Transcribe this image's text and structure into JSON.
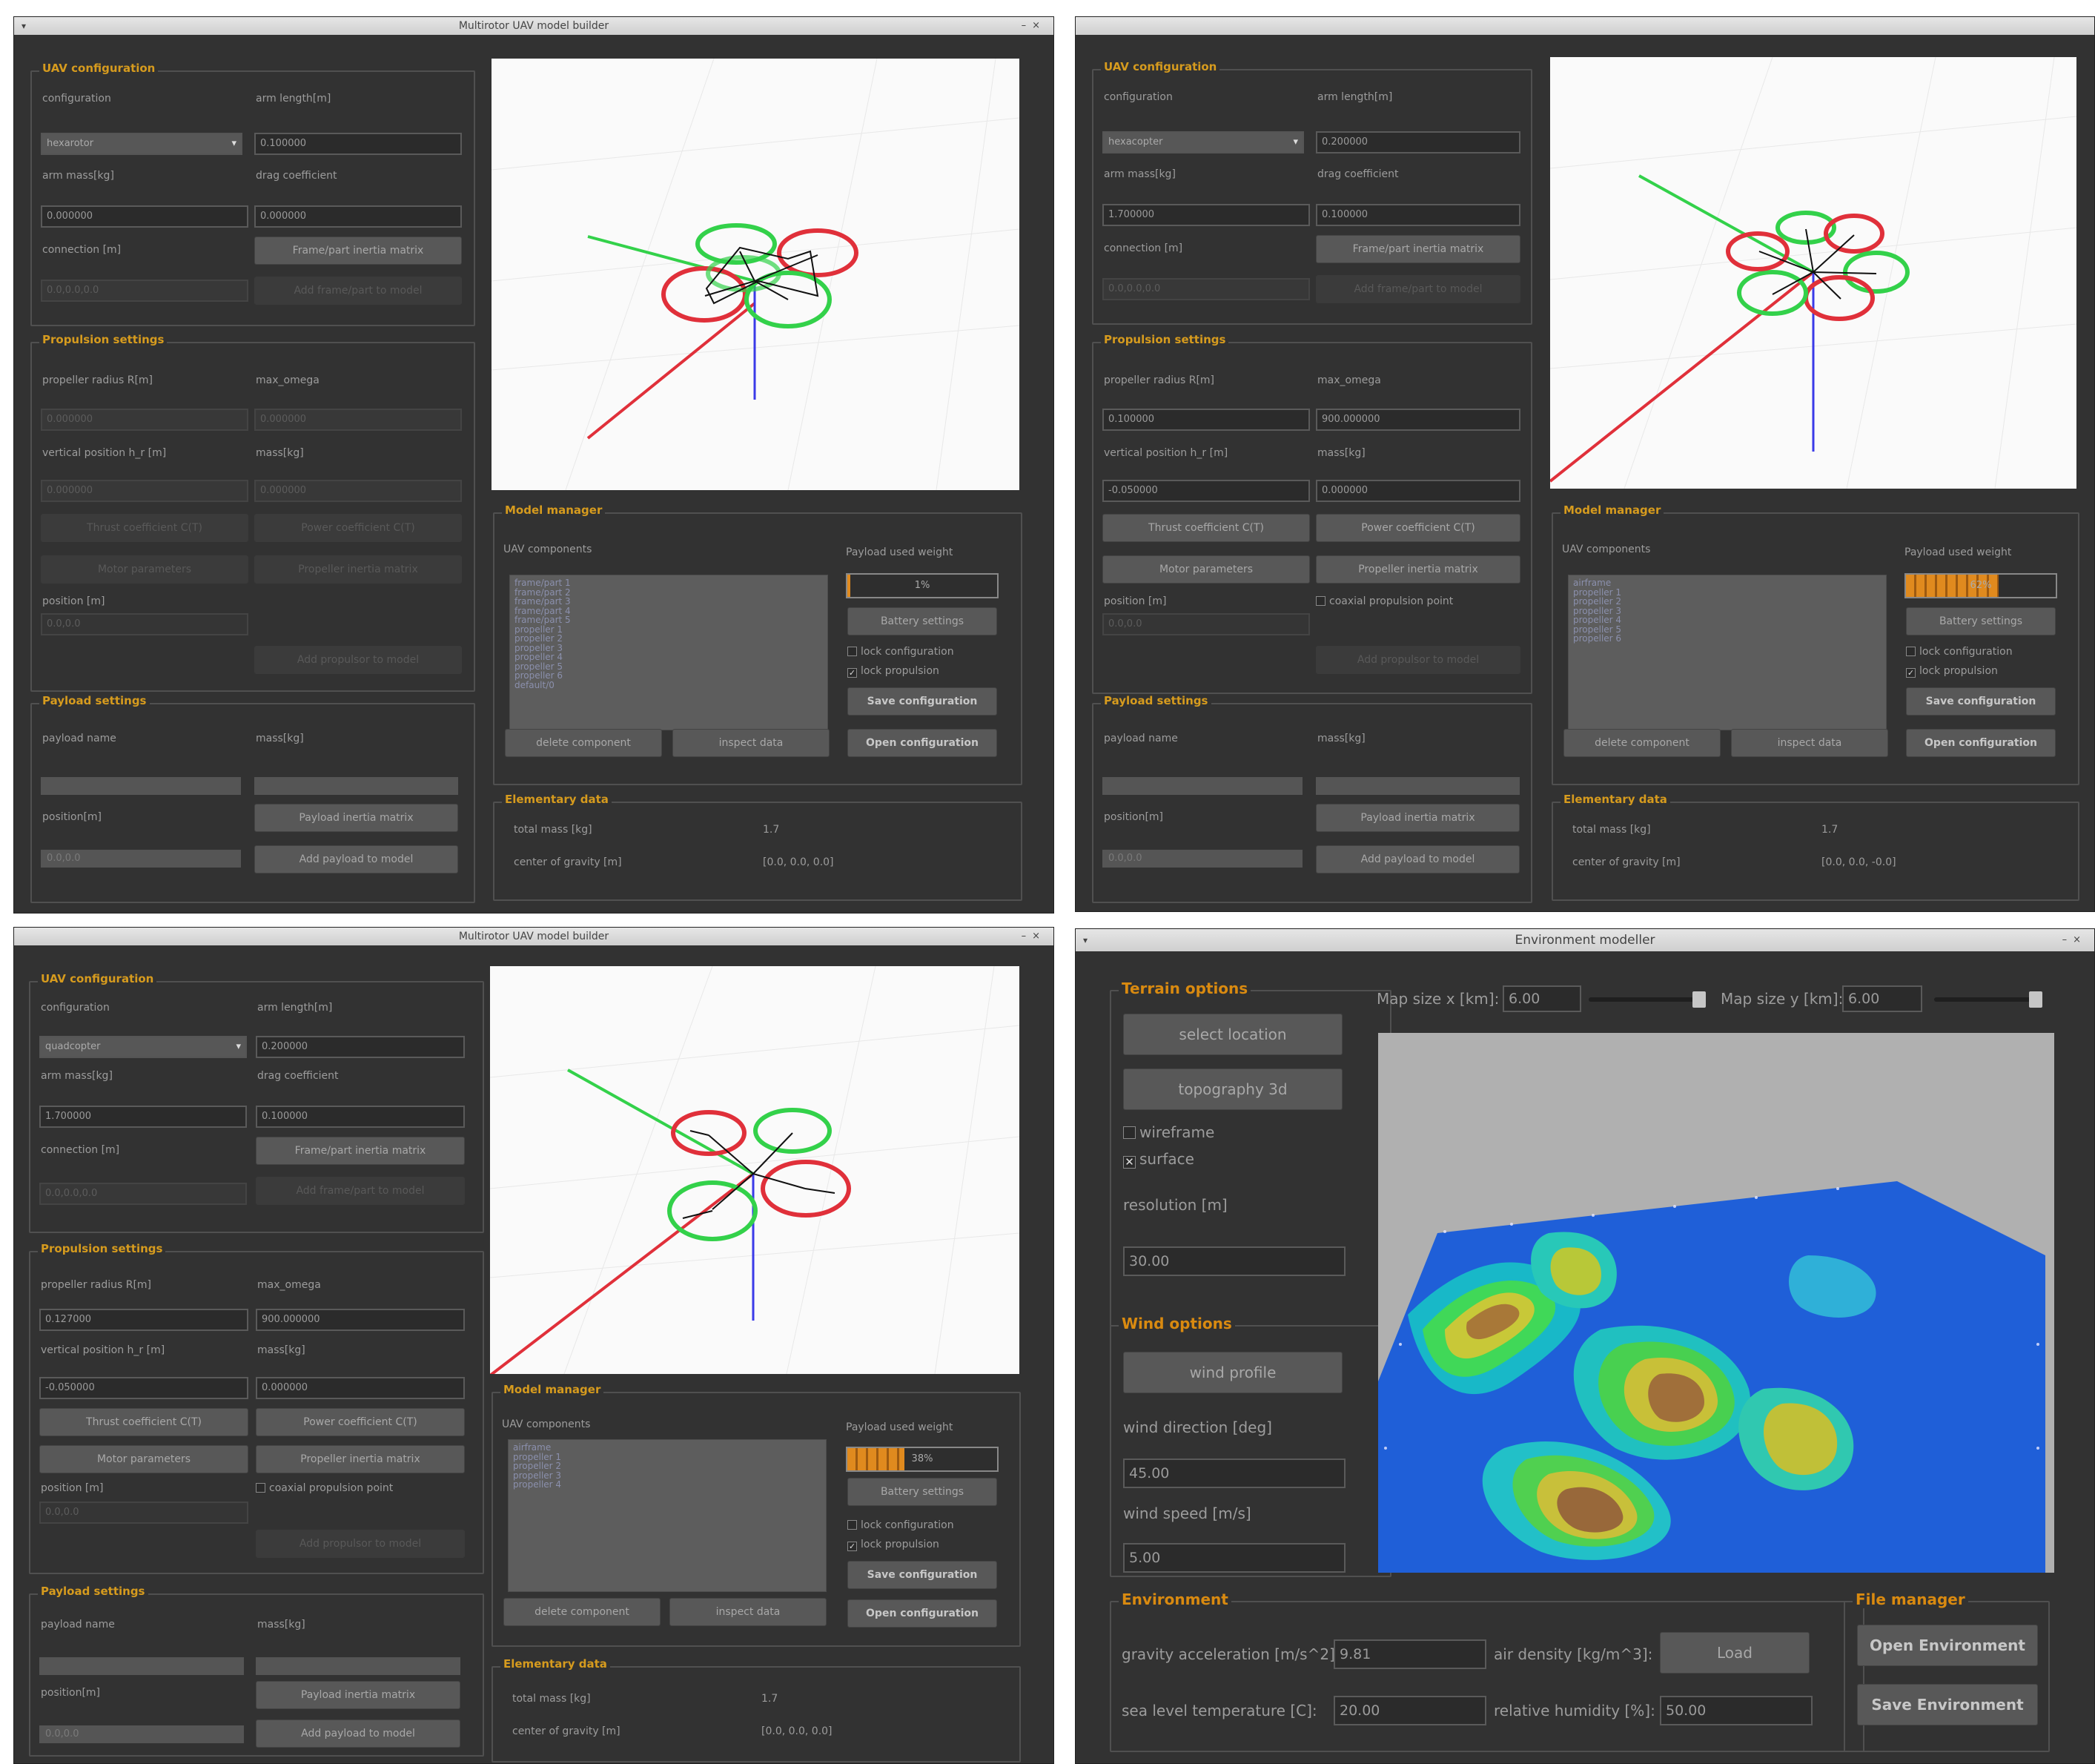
{
  "windows": {
    "w1": {
      "title": "Multirotor UAV model builder",
      "uav": {
        "section": "UAV configuration",
        "configuration_label": "configuration",
        "configuration_value": "hexarotor",
        "arm_length_label": "arm length[m]",
        "arm_length_value": "0.100000",
        "arm_mass_label": "arm mass[kg]",
        "arm_mass_value": "0.000000",
        "drag_label": "drag coefficient",
        "drag_value": "0.000000",
        "connection_label": "connection [m]",
        "connection_value": "0.0,0.0,0.0",
        "frame_btn": "Frame/part inertia matrix",
        "add_btn": "Add frame/part to model"
      },
      "prop": {
        "section": "Propulsion settings",
        "radius_label": "propeller radius R[m]",
        "radius_value": "0.000000",
        "omega_label": "max_omega",
        "omega_value": "0.000000",
        "vpos_label": "vertical position h_r [m]",
        "vpos_value": "0.000000",
        "mass_label": "mass[kg]",
        "mass_value": "0.000000",
        "thrust_btn": "Thrust coefficient C(T)",
        "power_btn": "Power coefficient C(T)",
        "motor_btn": "Motor parameters",
        "inertia_btn": "Propeller inertia matrix",
        "position_label": "position [m]",
        "position_value": "0.0,0.0",
        "add_btn": "Add propulsor to model"
      },
      "payload": {
        "section": "Payload settings",
        "name_label": "payload name",
        "mass_label": "mass[kg]",
        "position_label": "position[m]",
        "position_value": "0.0,0.0",
        "inertia_btn": "Payload inertia matrix",
        "add_btn": "Add payload to model"
      },
      "manager": {
        "section": "Model manager",
        "components_label": "UAV components",
        "components": [
          "frame/part 1",
          "frame/part 2",
          "frame/part 3",
          "frame/part 4",
          "frame/part 5",
          "propeller 1",
          "propeller 2",
          "propeller 3",
          "propeller 4",
          "propeller 5",
          "propeller 6",
          "default/0"
        ],
        "weight_label": "Payload used weight",
        "weight_pct": 0.02,
        "weight_text": "1%",
        "battery_btn": "Battery settings",
        "lock_config": "lock configuration",
        "lock_prop": "lock propulsion",
        "save_btn": "Save configuration",
        "open_btn": "Open configuration",
        "delete_btn": "delete component",
        "inspect_btn": "inspect data"
      },
      "elem": {
        "section": "Elementary data",
        "mass_label": "total mass [kg]",
        "mass_value": "1.7",
        "cog_label": "center of gravity [m]",
        "cog_value": "[0.0, 0.0, 0.0]"
      }
    },
    "w2": {
      "title": "",
      "uav": {
        "section": "UAV configuration",
        "configuration_label": "configuration",
        "configuration_value": "hexacopter",
        "arm_length_label": "arm length[m]",
        "arm_length_value": "0.200000",
        "arm_mass_label": "arm mass[kg]",
        "arm_mass_value": "1.700000",
        "drag_label": "drag coefficient",
        "drag_value": "0.100000",
        "connection_label": "connection [m]",
        "connection_value": "0.0,0.0,0.0",
        "frame_btn": "Frame/part inertia matrix",
        "add_btn": "Add frame/part to model"
      },
      "prop": {
        "section": "Propulsion settings",
        "radius_label": "propeller radius R[m]",
        "radius_value": "0.100000",
        "omega_label": "max_omega",
        "omega_value": "900.000000",
        "vpos_label": "vertical position h_r [m]",
        "vpos_value": "-0.050000",
        "mass_label": "mass[kg]",
        "mass_value": "0.000000",
        "thrust_btn": "Thrust coefficient C(T)",
        "power_btn": "Power coefficient C(T)",
        "motor_btn": "Motor parameters",
        "inertia_btn": "Propeller inertia matrix",
        "position_label": "position [m]",
        "coaxial": "coaxial propulsion point",
        "position_value": "0.0,0.0",
        "add_btn": "Add propulsor to model"
      },
      "payload": {
        "section": "Payload settings",
        "name_label": "payload name",
        "mass_label": "mass[kg]",
        "position_label": "position[m]",
        "position_value": "0.0,0.0",
        "inertia_btn": "Payload inertia matrix",
        "add_btn": "Add payload to model"
      },
      "manager": {
        "section": "Model manager",
        "components_label": "UAV components",
        "components": [
          "airframe",
          "propeller 1",
          "propeller 2",
          "propeller 3",
          "propeller 4",
          "propeller 5",
          "propeller 6"
        ],
        "weight_label": "Payload used weight",
        "weight_pct": 0.62,
        "weight_text": "62%",
        "battery_btn": "Battery settings",
        "lock_config": "lock configuration",
        "lock_prop": "lock propulsion",
        "save_btn": "Save configuration",
        "open_btn": "Open configuration",
        "delete_btn": "delete component",
        "inspect_btn": "inspect data"
      },
      "elem": {
        "section": "Elementary data",
        "mass_label": "total mass [kg]",
        "mass_value": "1.7",
        "cog_label": "center of gravity [m]",
        "cog_value": "[0.0, 0.0, -0.0]"
      }
    },
    "w3": {
      "title": "Multirotor UAV model builder",
      "uav": {
        "section": "UAV configuration",
        "configuration_label": "configuration",
        "configuration_value": "quadcopter",
        "arm_length_label": "arm length[m]",
        "arm_length_value": "0.200000",
        "arm_mass_label": "arm mass[kg]",
        "arm_mass_value": "1.700000",
        "drag_label": "drag coefficient",
        "drag_value": "0.100000",
        "connection_label": "connection [m]",
        "connection_value": "0.0,0.0,0.0",
        "frame_btn": "Frame/part inertia matrix",
        "add_btn": "Add frame/part to model"
      },
      "prop": {
        "section": "Propulsion settings",
        "radius_label": "propeller radius R[m]",
        "radius_value": "0.127000",
        "omega_label": "max_omega",
        "omega_value": "900.000000",
        "vpos_label": "vertical position h_r [m]",
        "vpos_value": "-0.050000",
        "mass_label": "mass[kg]",
        "mass_value": "0.000000",
        "thrust_btn": "Thrust coefficient C(T)",
        "power_btn": "Power coefficient C(T)",
        "motor_btn": "Motor parameters",
        "inertia_btn": "Propeller inertia matrix",
        "position_label": "position [m]",
        "coaxial": "coaxial propulsion point",
        "position_value": "0.0,0.0",
        "add_btn": "Add propulsor to model"
      },
      "payload": {
        "section": "Payload settings",
        "name_label": "payload name",
        "mass_label": "mass[kg]",
        "position_label": "position[m]",
        "position_value": "0.0,0.0",
        "inertia_btn": "Payload inertia matrix",
        "add_btn": "Add payload to model"
      },
      "manager": {
        "section": "Model manager",
        "components_label": "UAV components",
        "components": [
          "airframe",
          "propeller 1",
          "propeller 2",
          "propeller 3",
          "propeller 4"
        ],
        "weight_label": "Payload used weight",
        "weight_pct": 0.38,
        "weight_text": "38%",
        "battery_btn": "Battery settings",
        "lock_config": "lock configuration",
        "lock_prop": "lock propulsion",
        "save_btn": "Save configuration",
        "open_btn": "Open configuration",
        "delete_btn": "delete component",
        "inspect_btn": "inspect data"
      },
      "elem": {
        "section": "Elementary data",
        "mass_label": "total mass [kg]",
        "mass_value": "1.7",
        "cog_label": "center of gravity [m]",
        "cog_value": "[0.0, 0.0, 0.0]"
      }
    },
    "env": {
      "title": "Environment modeller",
      "terrain": {
        "section": "Terrain options",
        "select_btn": "select location",
        "topo_btn": "topography 3d",
        "wireframe": "wireframe",
        "surface": "surface",
        "res_label": "resolution [m]",
        "res_value": "30.00"
      },
      "map": {
        "x_label": "Map size x [km]:",
        "x_value": "6.00",
        "y_label": "Map size y [km]:",
        "y_value": "6.00"
      },
      "wind": {
        "section": "Wind options",
        "profile_btn": "wind profile",
        "dir_label": "wind direction [deg]",
        "dir_value": "45.00",
        "speed_label": "wind speed [m/s]",
        "speed_value": "5.00"
      },
      "environment": {
        "section": "Environment",
        "g_label": "gravity acceleration [m/s^2]:",
        "g_value": "9.81",
        "rho_label": "air density [kg/m^3]:",
        "load_btn": "Load",
        "temp_label": "sea level temperature [C]:",
        "temp_value": "20.00",
        "hum_label": "relative humidity [%]:",
        "hum_value": "50.00"
      },
      "files": {
        "section": "File manager",
        "open_btn": "Open Environment",
        "save_btn": "Save Environment"
      }
    }
  },
  "colors": {
    "panel": "#323232",
    "accent": "#d69b1e",
    "arm_red": "#e0303a",
    "arm_green": "#33d14a",
    "arm_blue": "#3a3ae8"
  }
}
